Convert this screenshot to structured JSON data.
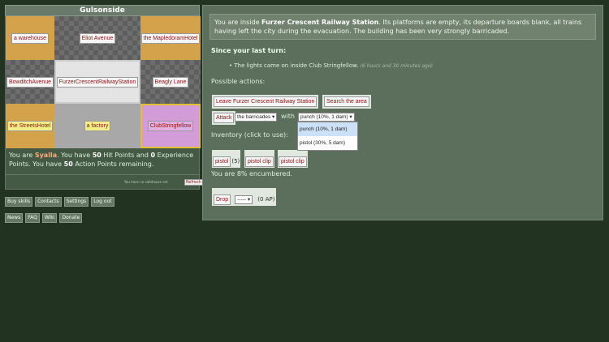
{
  "suburb_name": "Gulsonside",
  "map": {
    "cells": [
      {
        "label": "a warehouse",
        "type": "bldg-orange",
        "btn": "btn-white"
      },
      {
        "label": "Eliot Avenue",
        "type": "street",
        "btn": "btn-white"
      },
      {
        "label": "the MapledoramHotel",
        "type": "bldg-orange",
        "btn": "btn-white"
      },
      {
        "label": "BowditchAvenue",
        "type": "street",
        "btn": "btn-white"
      },
      {
        "label": "FurzerCrescentRailwayStation",
        "type": "bldg-light",
        "btn": "btn-white"
      },
      {
        "label": "Beagly Lane",
        "type": "street",
        "btn": "btn-white"
      },
      {
        "label": "the StreetsHotel",
        "type": "bldg-orange",
        "btn": "btn-yellow"
      },
      {
        "label": "a factory",
        "type": "bldg-gray",
        "btn": "btn-yellow"
      },
      {
        "label": "ClubStringfellow",
        "type": "bldg-pink",
        "btn": "btn-lilac"
      }
    ]
  },
  "status": {
    "you_are": "You are",
    "name": "Syalla",
    "have_hp": ". You have",
    "hp": "50",
    "hp_label": "Hit Points and",
    "xp": "0",
    "xp_label": "Experience Points. You have",
    "ap": "50",
    "ap_label": "Action Points remaining."
  },
  "substatus": {
    "text": "You have no safehouse set.",
    "button": "Refresh"
  },
  "links_row1": [
    "Buy skills",
    "Contacts",
    "Settings",
    "Log out"
  ],
  "links_row2": [
    "News",
    "FAQ",
    "Wiki",
    "Donate"
  ],
  "description": {
    "prefix": "You are inside",
    "place": "Furzer Crescent Railway Station",
    "rest": ". Its platforms are empty, its departure boards blank, all trains having left the city during the evacuation. The building has been very strongly barricaded."
  },
  "since_turn": "Since your last turn:",
  "event": {
    "text": "The lights came on inside Club Stringfellow.",
    "ago": "(6 hours and 30 minutes ago)"
  },
  "possible_actions": "Possible actions:",
  "actions": {
    "leave": "Leave Furzer Crescent Railway Station",
    "search": "Search the area"
  },
  "attack": {
    "button": "Attack",
    "target": "the barricades ▾",
    "with": "with",
    "weapon": "punch (10%, 1 dam) ▾",
    "options": [
      "punch (10%, 1 dam)",
      "pistol (30%, 5 dam)"
    ]
  },
  "inventory_label": "Inventory (click to use):",
  "inventory": [
    {
      "label": "pistol",
      "count": "(5)"
    },
    {
      "label": "pistol clip",
      "count": ""
    },
    {
      "label": "pistol clip",
      "count": ""
    }
  ],
  "encumbrance": "You are 8% encumbered.",
  "drop": {
    "button": "Drop",
    "select": "----- ▾",
    "cost": "(0 AP)"
  },
  "colors": {
    "background": "#223322",
    "panel": "#5c6e5c",
    "link_red": "#8a1010"
  }
}
